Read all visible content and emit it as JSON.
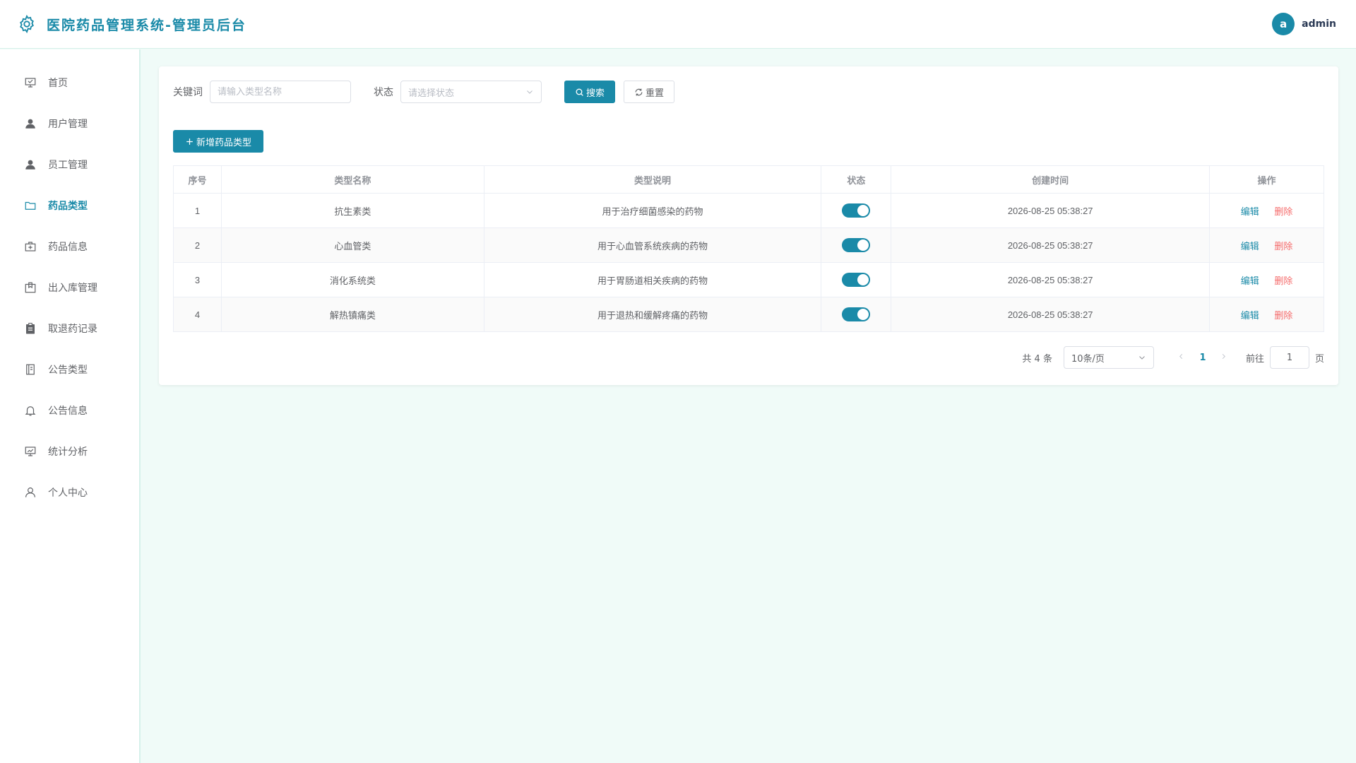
{
  "header": {
    "title": "医院药品管理系统-管理员后台",
    "avatar_initial": "a",
    "username": "admin"
  },
  "sidebar": {
    "items": [
      {
        "label": "首页",
        "icon": "presentation-icon"
      },
      {
        "label": "用户管理",
        "icon": "user-solid-icon"
      },
      {
        "label": "员工管理",
        "icon": "user-solid-icon"
      },
      {
        "label": "药品类型",
        "icon": "folder-icon",
        "active": true
      },
      {
        "label": "药品信息",
        "icon": "first-aid-kit-icon"
      },
      {
        "label": "出入库管理",
        "icon": "box-icon"
      },
      {
        "label": "取退药记录",
        "icon": "clipboard-icon"
      },
      {
        "label": "公告类型",
        "icon": "notebook-icon"
      },
      {
        "label": "公告信息",
        "icon": "bell-icon"
      },
      {
        "label": "统计分析",
        "icon": "data-board-icon"
      },
      {
        "label": "个人中心",
        "icon": "user-outline-icon"
      }
    ]
  },
  "search": {
    "keyword_label": "关键词",
    "keyword_placeholder": "请输入类型名称",
    "status_label": "状态",
    "status_placeholder": "请选择状态",
    "search_button": "搜索",
    "reset_button": "重置"
  },
  "add_button": "新增药品类型",
  "table": {
    "headers": [
      "序号",
      "类型名称",
      "类型说明",
      "状态",
      "创建时间",
      "操作"
    ],
    "rows": [
      {
        "index": "1",
        "name": "抗生素类",
        "desc": "用于治疗细菌感染的药物",
        "enabled": true,
        "created": "2026-08-25 05:38:27"
      },
      {
        "index": "2",
        "name": "心血管类",
        "desc": "用于心血管系统疾病的药物",
        "enabled": true,
        "created": "2026-08-25 05:38:27"
      },
      {
        "index": "3",
        "name": "消化系统类",
        "desc": "用于胃肠道相关疾病的药物",
        "enabled": true,
        "created": "2026-08-25 05:38:27"
      },
      {
        "index": "4",
        "name": "解热镇痛类",
        "desc": "用于退热和缓解疼痛的药物",
        "enabled": true,
        "created": "2026-08-25 05:38:27"
      }
    ],
    "edit_label": "编辑",
    "delete_label": "删除"
  },
  "pagination": {
    "total_text": "共 4 条",
    "page_size": "10条/页",
    "current_page": "1",
    "goto_label": "前往",
    "goto_value": "1",
    "page_unit": "页"
  },
  "colors": {
    "primary": "#1a8aa8",
    "danger": "#f56c6c",
    "background": "#f0fbf8"
  }
}
